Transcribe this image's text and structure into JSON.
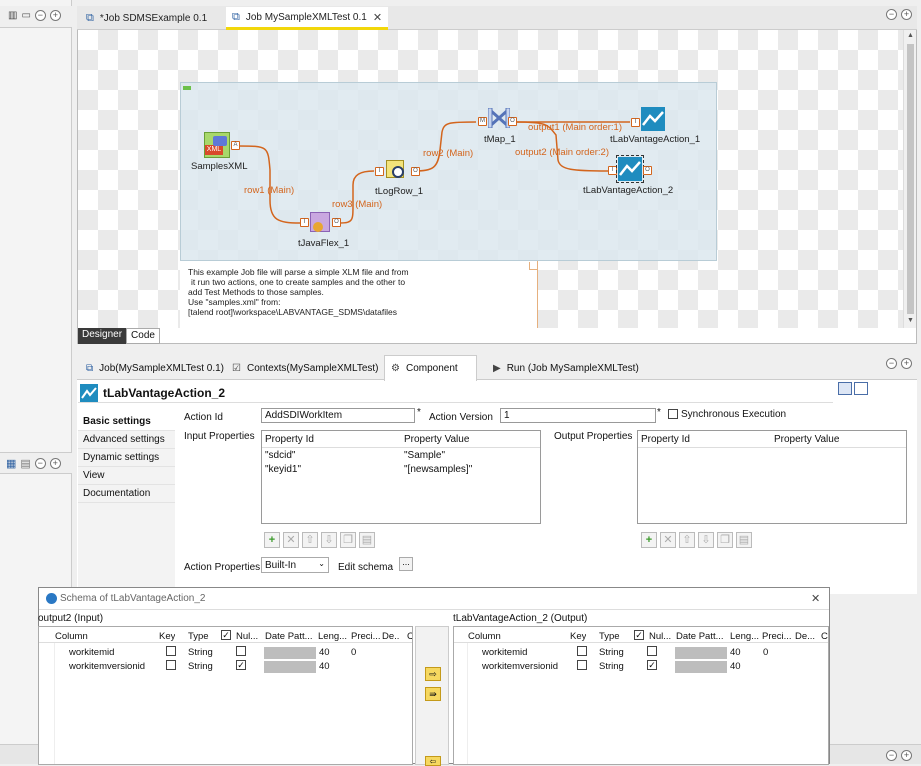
{
  "editor_tabs": [
    {
      "label": "*Job SDMSExample 0.1"
    },
    {
      "label": "Job MySampleXMLTest 0.1"
    }
  ],
  "components": {
    "samplesxml": "SamplesXML",
    "javaflex": "tJavaFlex_1",
    "logrow": "tLogRow_1",
    "tmap": "tMap_1",
    "action1": "tLabVantageAction_1",
    "action2": "tLabVantageAction_2",
    "xml_badge": "XML"
  },
  "flows": {
    "row1": "row1 (Main)",
    "row3": "row3 (Main)",
    "row2": "row2 (Main)",
    "output1": "output1 (Main order:1)",
    "output2": "output2 (Main order:2)"
  },
  "note_lines": [
    "This example Job file will parse a simple XLM file and from",
    "it run two actions, one to create samples and the other to",
    "add Test Methods to those samples.",
    "Use \"samples.xml\" from:",
    "[talend root]\\workspace\\LABVANTAGE_SDMS\\datafiles"
  ],
  "designer_tabs": {
    "designer": "Designer",
    "code": "Code"
  },
  "panel_tabs": [
    {
      "label": "Job(MySampleXMLTest 0.1)"
    },
    {
      "label": "Contexts(MySampleXMLTest)"
    },
    {
      "label": "Component"
    },
    {
      "label": "Run (Job MySampleXMLTest)"
    }
  ],
  "component_title": "tLabVantageAction_2",
  "left_menu": [
    "Basic settings",
    "Advanced settings",
    "Dynamic settings",
    "View",
    "Documentation"
  ],
  "form": {
    "action_id_label": "Action Id",
    "action_id_value": "AddSDIWorkItem",
    "action_version_label": "Action Version",
    "action_version_value": "1",
    "required_mark": "*",
    "sync_label": "Synchronous Execution",
    "input_props_label": "Input Properties",
    "output_props_label": "Output Properties",
    "prop_id_header": "Property Id",
    "prop_value_header": "Property Value",
    "input_rows": [
      {
        "id": "\"sdcid\"",
        "value": "\"Sample\""
      },
      {
        "id": "\"keyid1\"",
        "value": "\"[newsamples]\""
      }
    ],
    "action_props_label": "Action Properties",
    "action_props_value": "Built-In",
    "edit_schema": "Edit schema",
    "ellipsis": "..."
  },
  "dialog": {
    "title": "Schema of tLabVantageAction_2",
    "close": "✕",
    "input_title": "output2 (Input)",
    "output_title": "tLabVantageAction_2 (Output)",
    "headers": [
      "Column",
      "Key",
      "Type",
      "Nul...",
      "Date Patt...",
      "Leng...",
      "Preci...",
      "De...",
      "C"
    ],
    "rows": [
      {
        "column": "workitemid",
        "type": "String",
        "nullable": false,
        "length": "40",
        "precision": "0"
      },
      {
        "column": "workitemversionid",
        "type": "String",
        "nullable": true,
        "length": "40",
        "precision": ""
      }
    ]
  }
}
